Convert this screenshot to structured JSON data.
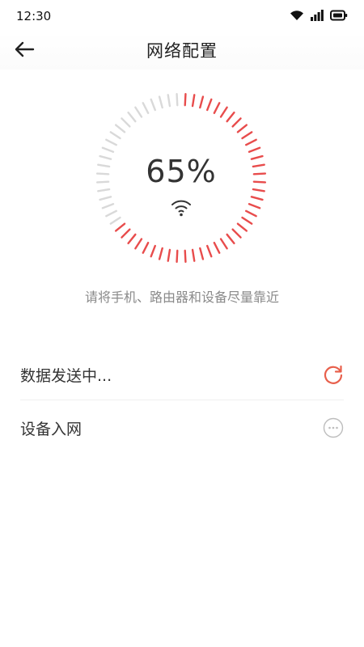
{
  "status_bar": {
    "time": "12:30",
    "icons": [
      "wifi-icon",
      "signal-icon",
      "battery-icon"
    ]
  },
  "header": {
    "title": "网络配置",
    "back_icon": "arrow-left-icon"
  },
  "progress": {
    "percent_text": "65%",
    "value": 0.65,
    "active_color": "#e84c4c",
    "inactive_color": "#d9d9d9",
    "center_icon": "wifi-icon"
  },
  "hint": "请将手机、路由器和设备尽量靠近",
  "steps": [
    {
      "label": "数据发送中...",
      "status": "in-progress",
      "icon": "refresh-icon",
      "color": "#e8604c"
    },
    {
      "label": "设备入网",
      "status": "pending",
      "icon": "more-circle-icon",
      "color": "#bdbdbd"
    }
  ]
}
